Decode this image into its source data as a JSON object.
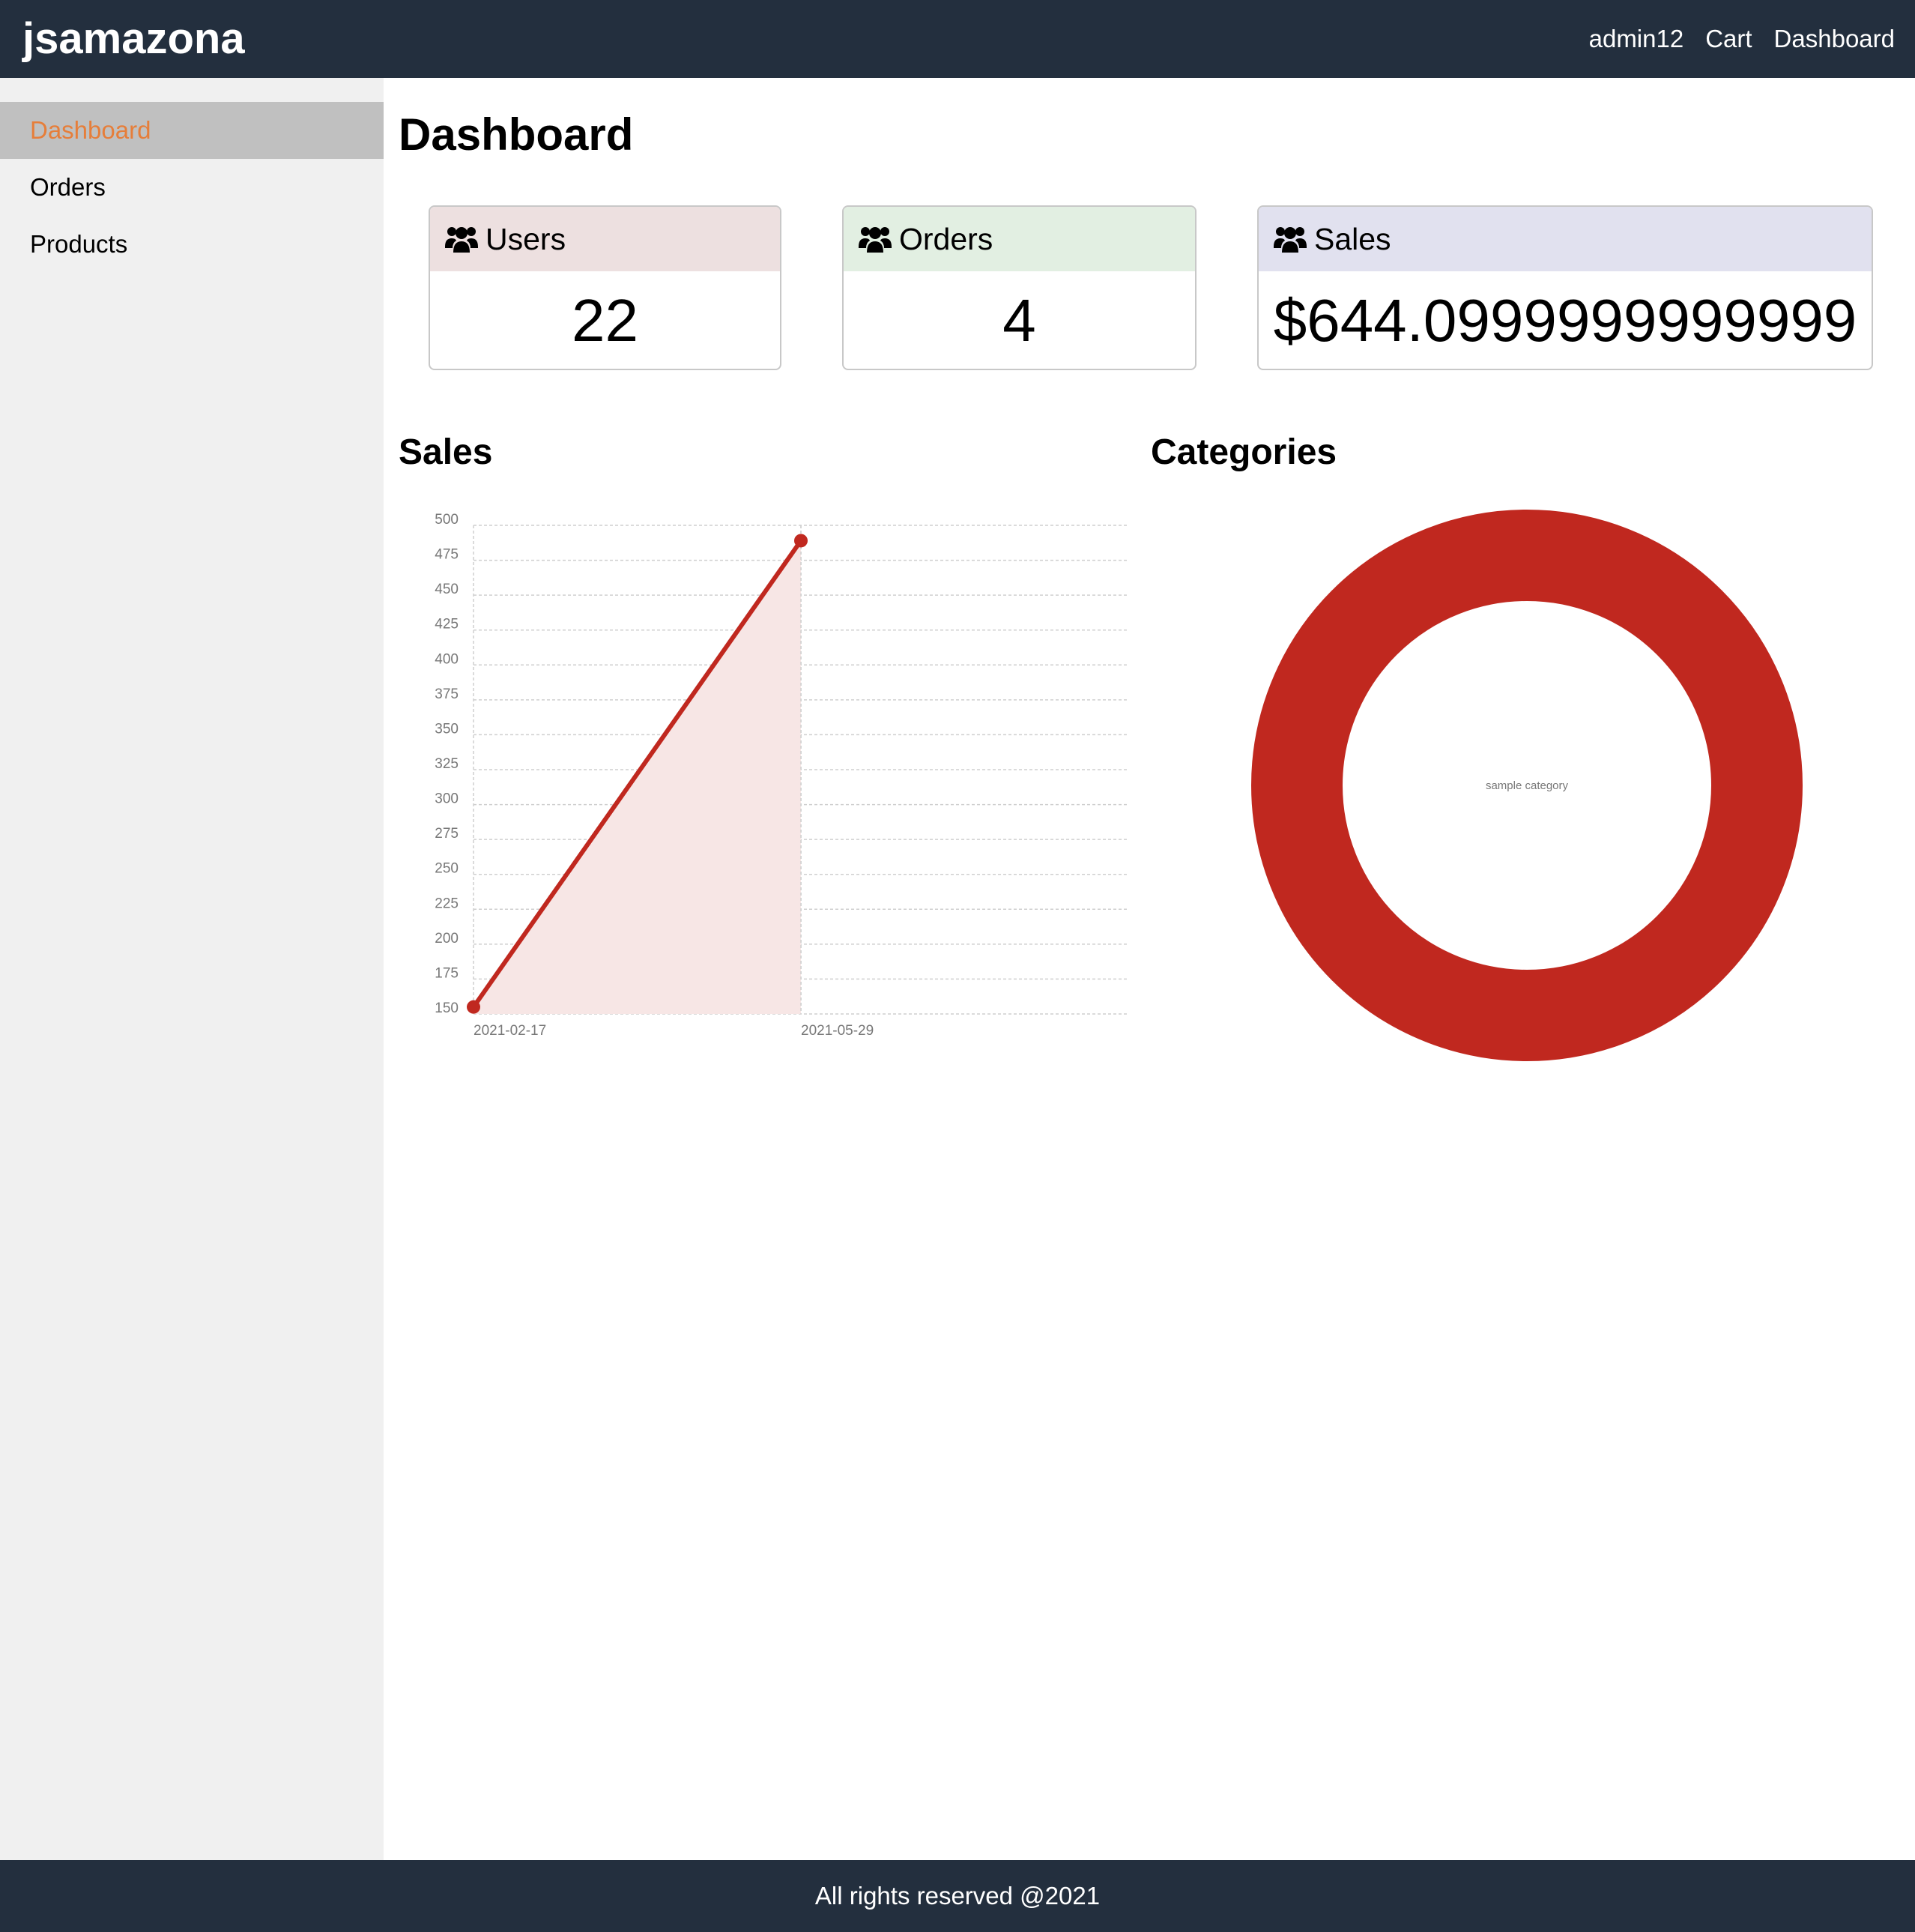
{
  "header": {
    "brand": "jsamazona",
    "links": {
      "user": "admin12",
      "cart": "Cart",
      "dashboard": "Dashboard"
    }
  },
  "sidebar": {
    "items": [
      {
        "label": "Dashboard",
        "active": true
      },
      {
        "label": "Orders",
        "active": false
      },
      {
        "label": "Products",
        "active": false
      }
    ]
  },
  "main": {
    "title": "Dashboard",
    "cards": [
      {
        "label": "Users",
        "value": "22",
        "icon": "users-icon",
        "header_color": "#ede0e0"
      },
      {
        "label": "Orders",
        "value": "4",
        "icon": "users-icon",
        "header_color": "#e2efe2"
      },
      {
        "label": "Sales",
        "value": "$644.0999999999999",
        "icon": "users-icon",
        "header_color": "#e1e1ef"
      }
    ],
    "sales_title": "Sales",
    "categories_title": "Categories"
  },
  "chart_data": [
    {
      "type": "area",
      "title": "Sales",
      "x": [
        "2021-02-17",
        "2021-05-29"
      ],
      "values": [
        155,
        489
      ],
      "ylim": [
        150,
        500
      ],
      "yticks": [
        150,
        175,
        200,
        225,
        250,
        275,
        300,
        325,
        350,
        375,
        400,
        425,
        450,
        475,
        500
      ],
      "grid": true,
      "color": "#c0281f",
      "fill_color": "#f7e6e5"
    },
    {
      "type": "pie",
      "title": "Categories",
      "donut": true,
      "labels": [
        "sample category"
      ],
      "values": [
        1
      ],
      "color": "#c0281f"
    }
  ],
  "footer": {
    "text": "All rights reserved @2021"
  }
}
